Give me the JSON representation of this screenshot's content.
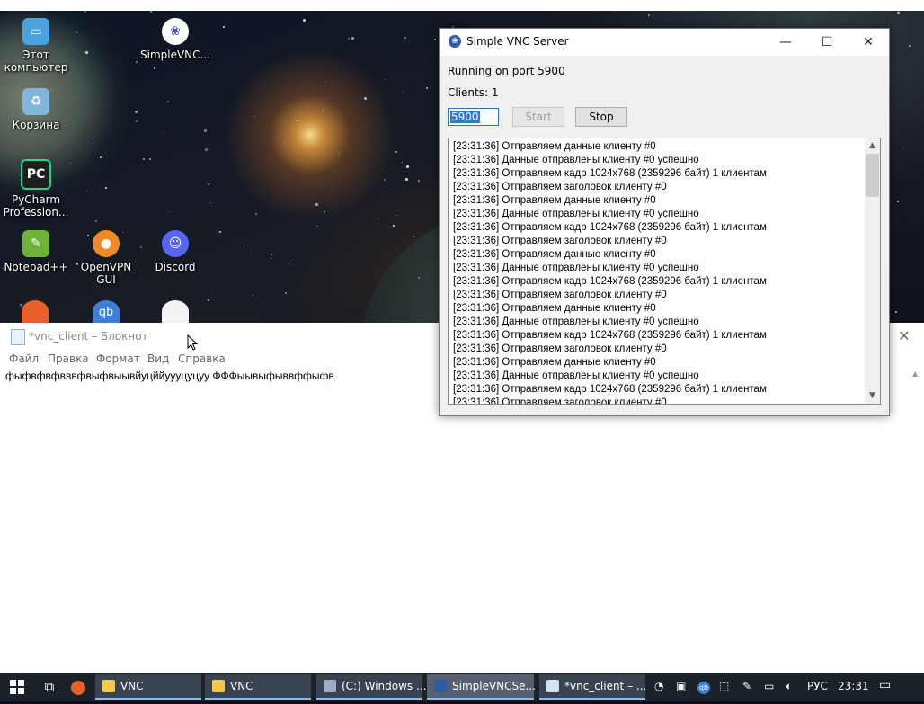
{
  "desktop": {
    "icons": [
      {
        "label": "Этот компьютер",
        "icon": "computer-icon",
        "color": "#4aa3df"
      },
      {
        "label": "SimpleVNC...",
        "icon": "vnc-paw-icon",
        "color": "#2f5aa8"
      },
      {
        "label": "Корзина",
        "icon": "recycle-bin-icon",
        "color": "#7fb6d9"
      },
      {
        "label": "PyCharm Profession...",
        "icon": "pycharm-icon",
        "color": "#1e1e1e"
      },
      {
        "label": "Notepad++",
        "icon": "notepadpp-icon",
        "color": "#6fb33a"
      },
      {
        "label": "OpenVPN GUI",
        "icon": "openvpn-icon",
        "color": "#f08a24"
      },
      {
        "label": "Discord",
        "icon": "discord-icon",
        "color": "#5865f2"
      }
    ]
  },
  "notepad": {
    "title": "*vnc_client – Блокнот",
    "menu": [
      "Файл",
      "Правка",
      "Формат",
      "Вид",
      "Справка"
    ],
    "content": "фыфвфвфвввфвыфвыывйуцййуууцуцуу ФФФыывыфыввффыфв"
  },
  "vnc": {
    "title": "Simple VNC Server",
    "status": "Running on port 5900",
    "clients": "Clients: 1",
    "port_value": "5900",
    "start_label": "Start",
    "stop_label": "Stop",
    "log": [
      "[23:31:36] Отправляем данные клиенту #0",
      "[23:31:36] Данные отправлены клиенту #0 успешно",
      "[23:31:36] Отправляем кадр 1024x768 (2359296 байт) 1 клиентам",
      "[23:31:36] Отправляем заголовок клиенту #0",
      "[23:31:36] Отправляем данные клиенту #0",
      "[23:31:36] Данные отправлены клиенту #0 успешно",
      "[23:31:36] Отправляем кадр 1024x768 (2359296 байт) 1 клиентам",
      "[23:31:36] Отправляем заголовок клиенту #0",
      "[23:31:36] Отправляем данные клиенту #0",
      "[23:31:36] Данные отправлены клиенту #0 успешно",
      "[23:31:36] Отправляем кадр 1024x768 (2359296 байт) 1 клиентам",
      "[23:31:36] Отправляем заголовок клиенту #0",
      "[23:31:36] Отправляем данные клиенту #0",
      "[23:31:36] Данные отправлены клиенту #0 успешно",
      "[23:31:36] Отправляем кадр 1024x768 (2359296 байт) 1 клиентам",
      "[23:31:36] Отправляем заголовок клиенту #0",
      "[23:31:36] Отправляем данные клиенту #0",
      "[23:31:36] Данные отправлены клиенту #0 успешно",
      "[23:31:36] Отправляем кадр 1024x768 (2359296 байт) 1 клиентам",
      "[23:31:36] Отправляем заголовок клиенту #0"
    ]
  },
  "taskbar": {
    "apps": [
      {
        "label": "VNC",
        "icon": "folder-icon",
        "color": "#f2c94c",
        "active": false
      },
      {
        "label": "VNC",
        "icon": "folder-icon",
        "color": "#f2c94c",
        "active": false
      },
      {
        "label": "(C:) Windows ...",
        "icon": "drive-icon",
        "color": "#9ab0c8",
        "active": false
      },
      {
        "label": "SimpleVNCSe...",
        "icon": "vnc-paw-icon",
        "color": "#2f5aa8",
        "active": true
      },
      {
        "label": "*vnc_client – ...",
        "icon": "notepad-icon",
        "color": "#cfe3f3",
        "active": false
      }
    ],
    "language": "РУС",
    "clock": "23:31"
  }
}
